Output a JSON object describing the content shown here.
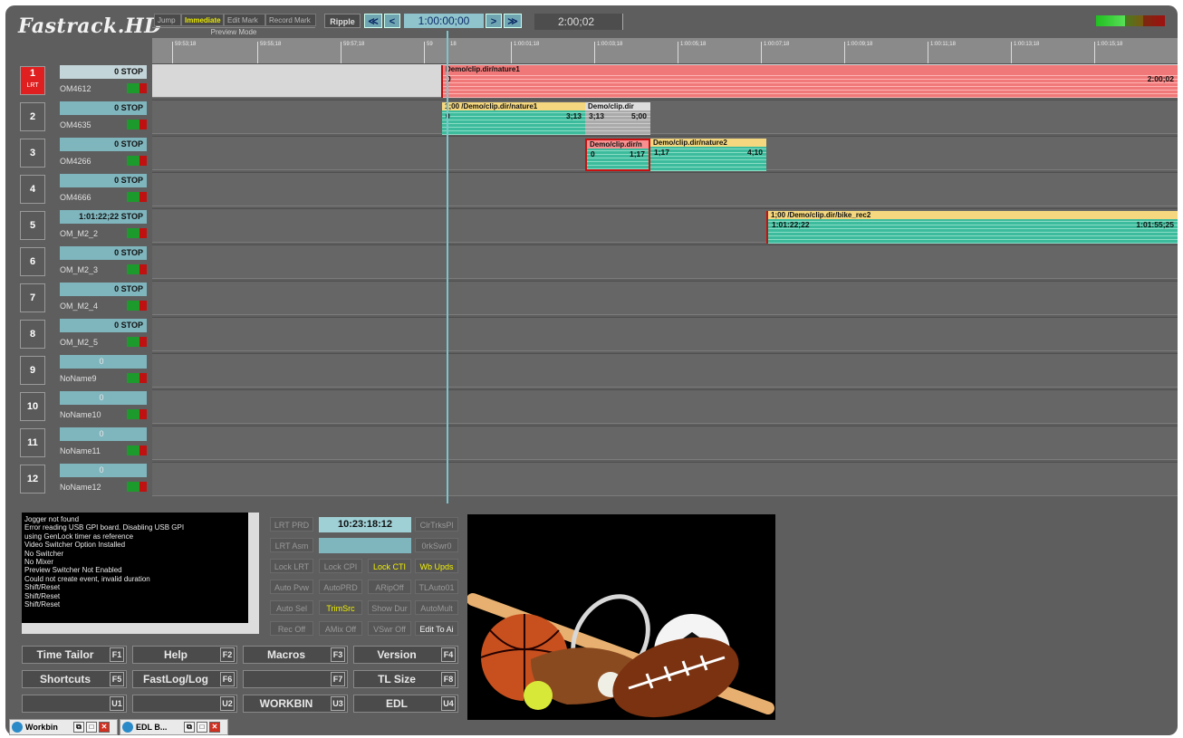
{
  "app": {
    "logo": "Fastrack.HD"
  },
  "toolbar": {
    "modes": [
      "Jump",
      "Immediate",
      "Edit Mark",
      "Record Mark"
    ],
    "preview_mode": "Preview Mode",
    "ripple": "Ripple",
    "rewind_fast": "≪",
    "rewind": "<",
    "cti_timecode": "1:00:00;00",
    "forward": ">",
    "forward_fast": "≫",
    "duration": "2:00;02"
  },
  "ruler": {
    "ticks": [
      "59:53;18",
      "59:55;18",
      "59:57;18",
      "59",
      "18",
      "1:00:01;18",
      "1:00:03;18",
      "1:00:05;18",
      "1:00:07;18",
      "1:00:09;18",
      "1:00:11;18",
      "1:00:13;18",
      "1:00:15;18"
    ]
  },
  "tracks": [
    {
      "num": "1",
      "sub": "LRT",
      "tc": "0 STOP",
      "device": "OM4612"
    },
    {
      "num": "2",
      "tc": "0 STOP",
      "device": "OM4635"
    },
    {
      "num": "3",
      "tc": "0 STOP",
      "device": "OM4266"
    },
    {
      "num": "4",
      "tc": "0 STOP",
      "device": "OM4666"
    },
    {
      "num": "5",
      "tc": "1:01:22;22 STOP",
      "device": "OM_M2_2"
    },
    {
      "num": "6",
      "tc": "0 STOP",
      "device": "OM_M2_3"
    },
    {
      "num": "7",
      "tc": "0 STOP",
      "device": "OM_M2_4"
    },
    {
      "num": "8",
      "tc": "0 STOP",
      "device": "OM_M2_5"
    },
    {
      "num": "9",
      "tc": "0",
      "device": "NoName9"
    },
    {
      "num": "10",
      "tc": "0",
      "device": "NoName10"
    },
    {
      "num": "11",
      "tc": "0",
      "device": "NoName11"
    },
    {
      "num": "12",
      "tc": "0",
      "device": "NoName12"
    }
  ],
  "clips": {
    "t1": {
      "name": "Demo/clip.dir/nature1",
      "in": "0",
      "out": "2:00;02"
    },
    "t2a": {
      "name": "1;00 /Demo/clip.dir/nature1",
      "in": "0",
      "out": "3;13"
    },
    "t2b": {
      "name": "Demo/clip.dir",
      "in": "3;13",
      "out": "5;00"
    },
    "t3a": {
      "name": "Demo/clip.dir/n",
      "in": "0",
      "out": "1;17"
    },
    "t3b": {
      "name": "Demo/clip.dir/nature2",
      "in": "1;17",
      "out": "4;10"
    },
    "t5": {
      "name": "1;00 /Demo/clip.dir/bike_rec2",
      "in": "1:01:22;22",
      "out": "1:01:55;25"
    }
  },
  "log": {
    "lines": [
      "Jogger not found",
      "Error reading USB GPI board.  Disabling USB GPI",
      "using GenLock timer as reference",
      "Video Switcher Option Installed",
      "No Switcher",
      "No Mixer",
      "Preview Switcher Not Enabled",
      "Could not create event, invalid duration",
      "Shift/Reset",
      "Shift/Reset",
      "Shift/Reset"
    ]
  },
  "controls": {
    "clock": "10:23:18:12",
    "buttons": {
      "lrt_prd": "LRT PRD",
      "clr_trks": "ClrTrksPl",
      "lrt_asm": "LRT Asm",
      "ork_swr": "0rkSwr0",
      "lock_lrt": "Lock LRT",
      "lock_cpi": "Lock CPI",
      "lock_cti": "Lock CTI",
      "wb_upds": "Wb Upds",
      "auto_pvw": "Auto Pvw",
      "auto_prd": "AutoPRD",
      "arip_off": "ARipOff",
      "tl_auto": "TLAuto01",
      "auto_sel": "Auto Sel",
      "trim_src": "TrimSrc",
      "show_dur": "Show Dur",
      "auto_mult": "AutoMult",
      "rec_off": "Rec Off",
      "amix_off": "AMix Off",
      "vswr_off": "VSwr Off",
      "edit_to_ai": "Edit To Ai"
    }
  },
  "fkeys": [
    {
      "label": "Time Tailor",
      "key": "F1"
    },
    {
      "label": "Help",
      "key": "F2"
    },
    {
      "label": "Macros",
      "key": "F3"
    },
    {
      "label": "Version",
      "key": "F4"
    },
    {
      "label": "Shortcuts",
      "key": "F5"
    },
    {
      "label": "FastLog/Log",
      "key": "F6"
    },
    {
      "label": "",
      "key": "F7"
    },
    {
      "label": "TL Size",
      "key": "F8"
    },
    {
      "label": "",
      "key": "U1"
    },
    {
      "label": "",
      "key": "U2"
    },
    {
      "label": "WORKBIN",
      "key": "U3"
    },
    {
      "label": "EDL",
      "key": "U4"
    }
  ],
  "taskbar": [
    {
      "label": "Workbin"
    },
    {
      "label": "EDL B..."
    }
  ],
  "colors": {
    "lrt_red": "#e02020",
    "clip_pink": "#f07878",
    "clip_teal": "#3cbc9c",
    "clip_header": "#f4d77e",
    "cti_blue": "#7ec4cc"
  }
}
